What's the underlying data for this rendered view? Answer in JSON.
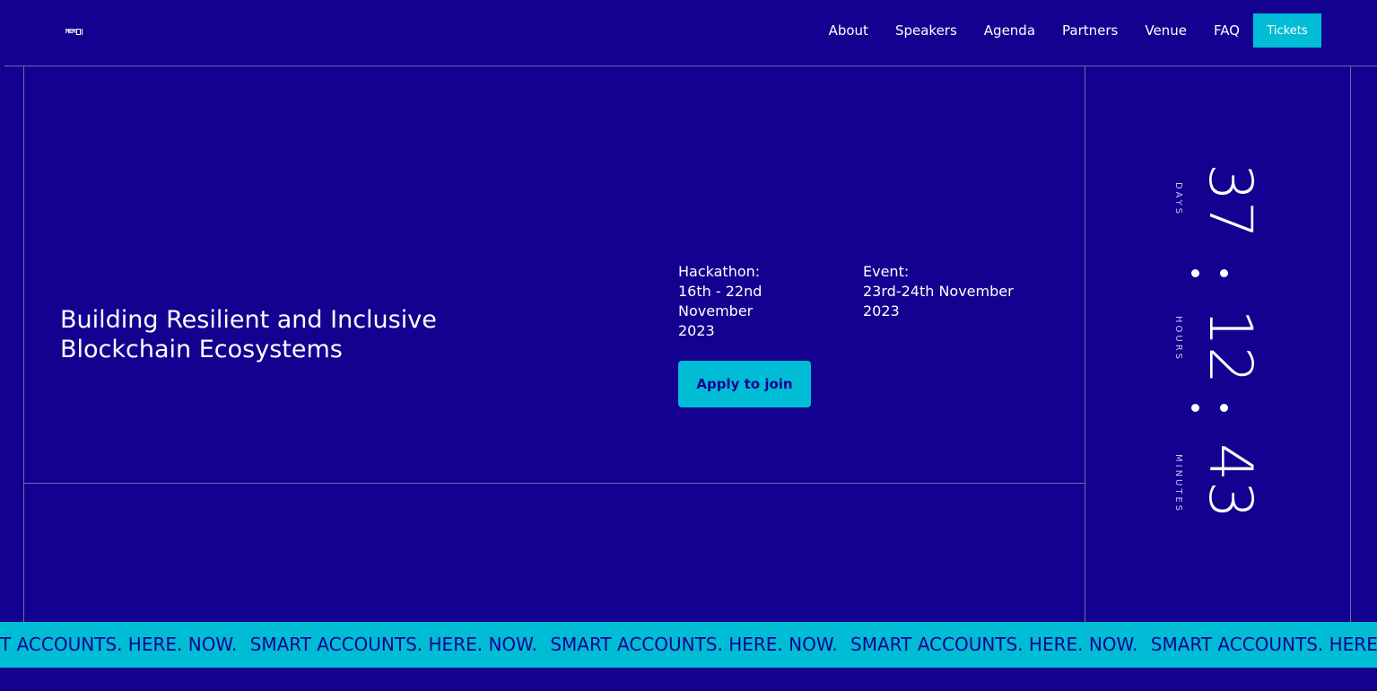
{
  "logo": {
    "text": "MEM"
  },
  "nav": {
    "items": [
      "About",
      "Speakers",
      "Agenda",
      "Partners",
      "Venue",
      "FAQ"
    ],
    "tickets_label": "Tickets"
  },
  "hero": {
    "headline_line1": "Building Resilient and Inclusive",
    "headline_line2": "Blockchain Ecosystems",
    "hackathon": {
      "label": "Hackathon:",
      "line1": "16th - 22nd",
      "line2": "November",
      "line3": "2023"
    },
    "event": {
      "label": "Event:",
      "line1": "23rd-24th November",
      "line2": "2023"
    },
    "apply_label": "Apply to join"
  },
  "countdown": {
    "days": "37",
    "days_label": "DAYS",
    "hours": "12",
    "hours_label": "HOURS",
    "minutes": "43",
    "minutes_label": "MINUTES"
  },
  "ticker": {
    "items": [
      "T ACCOUNTS. HERE. NOW.",
      "SMART ACCOUNTS. HERE. NOW.",
      "SMART ACCOUNTS. HERE. NOW.",
      "SMART ACCOUNTS. HERE. NOW.",
      "SMART ACCOUNTS. HERE."
    ]
  },
  "colors": {
    "background": "#12028f",
    "accent": "#00bcd4",
    "text": "#ffffff"
  }
}
